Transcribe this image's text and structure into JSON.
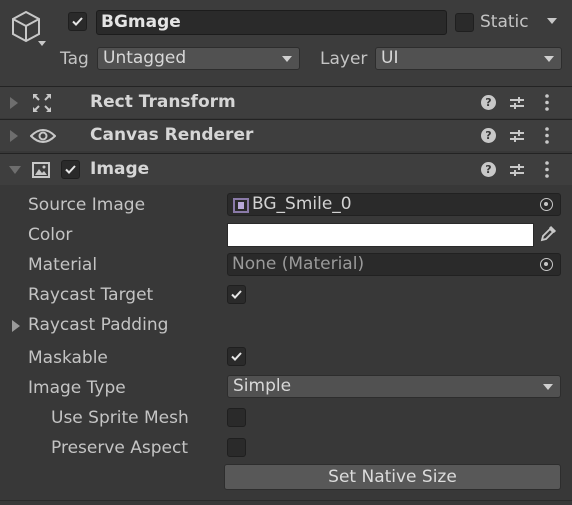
{
  "header": {
    "object_name": "BGmage",
    "active": true,
    "static_label": "Static",
    "static_checked": false,
    "tag_label": "Tag",
    "tag_value": "Untagged",
    "layer_label": "Layer",
    "layer_value": "UI"
  },
  "components": [
    {
      "title": "Rect Transform",
      "icon": "rect-transform-icon",
      "expanded": false
    },
    {
      "title": "Canvas Renderer",
      "icon": "eye-icon",
      "expanded": false
    },
    {
      "title": "Image",
      "icon": "image-icon",
      "expanded": true,
      "enabled": true
    }
  ],
  "image": {
    "source_image_label": "Source Image",
    "source_image_value": "BG_Smile_0",
    "color_label": "Color",
    "color_value": "#ffffff",
    "material_label": "Material",
    "material_value": "None (Material)",
    "raycast_target_label": "Raycast Target",
    "raycast_target": true,
    "raycast_padding_label": "Raycast Padding",
    "maskable_label": "Maskable",
    "maskable": true,
    "image_type_label": "Image Type",
    "image_type_value": "Simple",
    "use_sprite_mesh_label": "Use Sprite Mesh",
    "use_sprite_mesh": false,
    "preserve_aspect_label": "Preserve Aspect",
    "preserve_aspect": false,
    "set_native_size_label": "Set Native Size"
  },
  "colors": {
    "panel_bg": "#383838",
    "header_bg": "#3e3e3e",
    "field_bg": "#2a2a2a",
    "button_bg": "#585858"
  }
}
